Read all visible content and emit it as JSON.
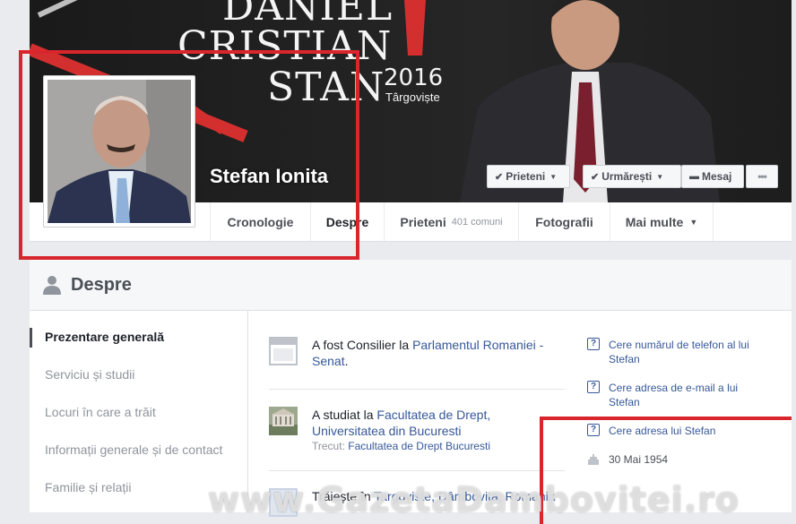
{
  "cover": {
    "title_line1": "DANIEL",
    "title_line2": "CRISTIAN",
    "title_line3": "STAN",
    "year": "2016",
    "city": "Târgoviște"
  },
  "profile": {
    "name": "Stefan Ionita"
  },
  "actions": {
    "friends": "Prieteni",
    "follow": "Urmărești",
    "message": "Mesaj",
    "more": "•••"
  },
  "tabs": [
    {
      "label": "Cronologie"
    },
    {
      "label": "Despre"
    },
    {
      "label": "Prieteni",
      "count": "401 comuni"
    },
    {
      "label": "Fotografii"
    },
    {
      "label": "Mai multe"
    }
  ],
  "about": {
    "title": "Despre",
    "nav": [
      "Prezentare generală",
      "Serviciu și studii",
      "Locuri în care a trăit",
      "Informații generale și de contact",
      "Familie și relații"
    ],
    "work": {
      "prefix": "A fost Consilier la ",
      "link": "Parlamentul Romaniei - Senat",
      "suffix": "."
    },
    "education": {
      "prefix": "A studiat la ",
      "link": "Facultatea de Drept, Universitatea din Bucuresti",
      "sub_prefix": "Trecut: ",
      "sub_link": "Facultatea de Drept Bucuresti"
    },
    "lives": {
      "prefix": "Trăiește în ",
      "link": "Targoviste, Dâmbovita, Romania"
    },
    "requests": [
      "Cere numărul de telefon al lui Stefan",
      "Cere adresa de e-mail a lui Stefan",
      "Cere adresa lui Stefan"
    ],
    "birthday": "30 Mai 1954"
  },
  "watermark": "www.GazetaDambovitei.ro",
  "colors": {
    "highlight_box": "#d9262c",
    "link": "#365899",
    "background": "#e9ebee"
  }
}
